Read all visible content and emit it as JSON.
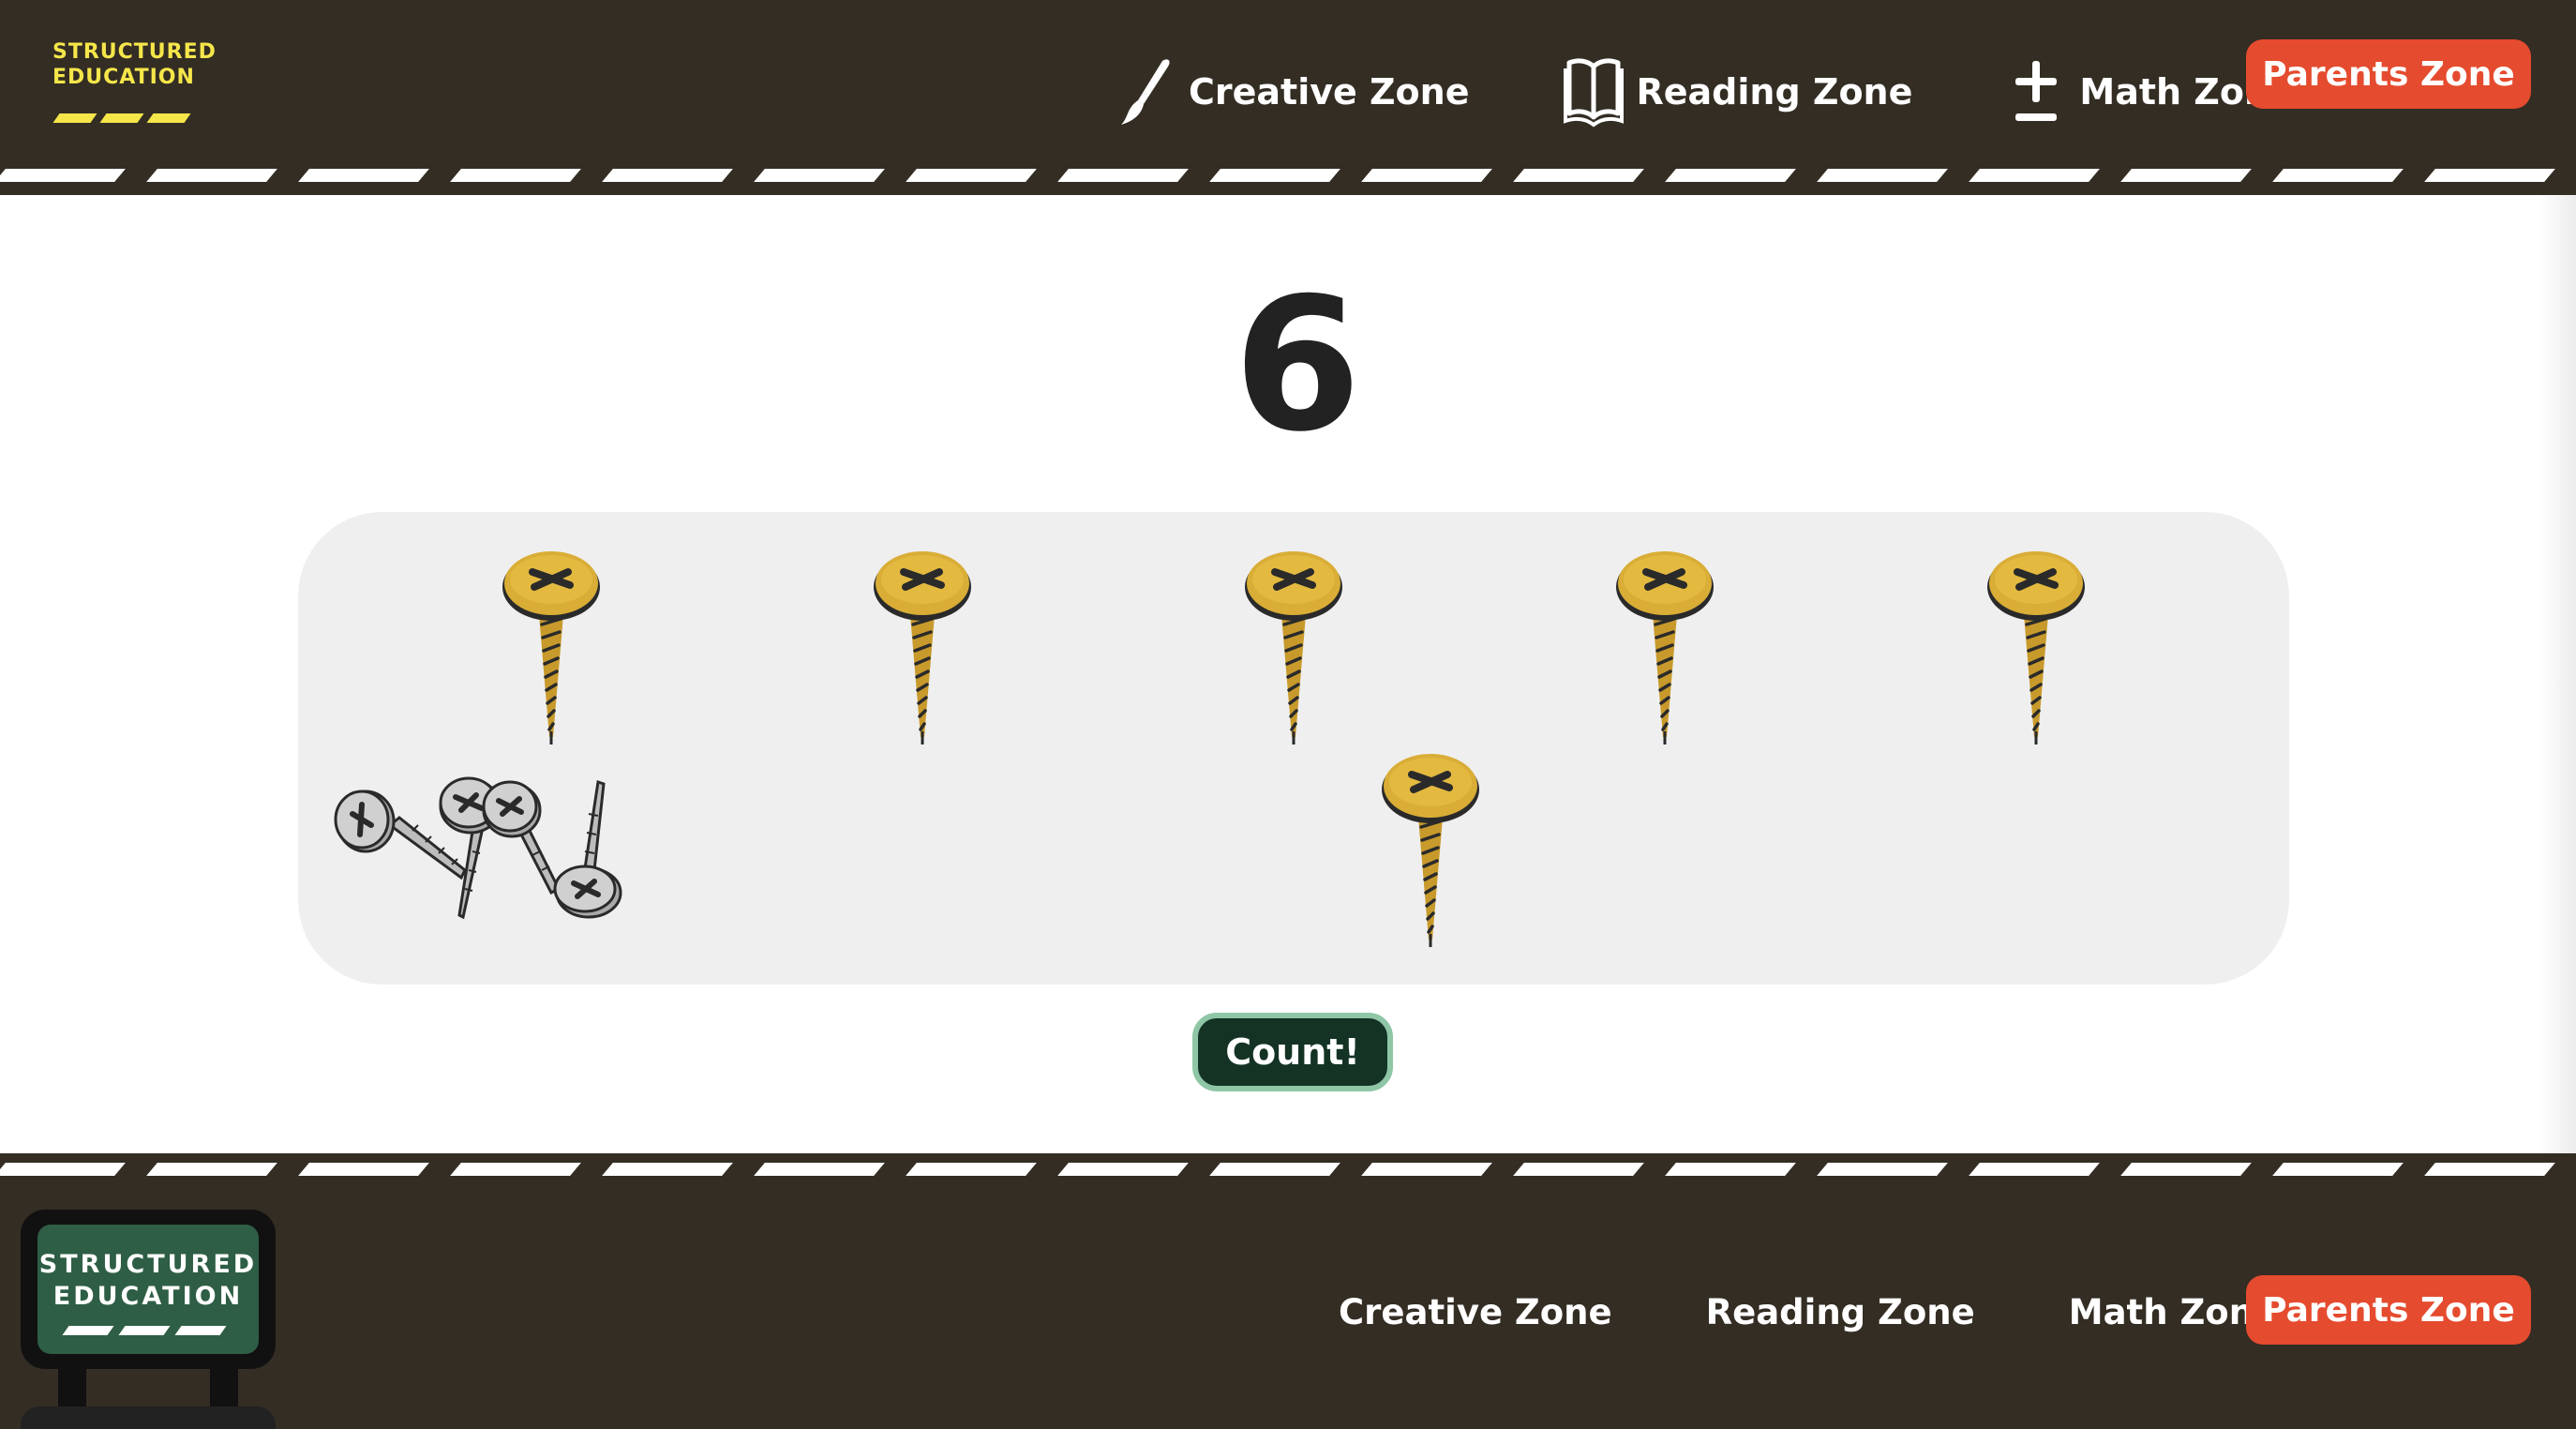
{
  "header": {
    "logo_line1": "STRUCTURED",
    "logo_line2": "EDUCATION",
    "nav": [
      {
        "label": "Creative Zone",
        "icon": "paintbrush-icon"
      },
      {
        "label": "Reading Zone",
        "icon": "book-icon"
      },
      {
        "label": "Math Zone",
        "icon": "plus-minus-icon"
      }
    ],
    "parents_label": "Parents Zone"
  },
  "main": {
    "number": "6",
    "screw_count": 6,
    "count_label": "Count!"
  },
  "footer": {
    "logo_line1": "STRUCTURED",
    "logo_line2": "EDUCATION",
    "nav": [
      "Creative Zone",
      "Reading Zone",
      "Math Zone"
    ],
    "parents_label": "Parents Zone"
  },
  "colors": {
    "dark": "#332d24",
    "accent_red": "#e54b2e",
    "logo_yellow": "#f5e64a",
    "screw_gold": "#d9ad36",
    "button_green": "#143325",
    "sign_green": "#2e5e45"
  }
}
